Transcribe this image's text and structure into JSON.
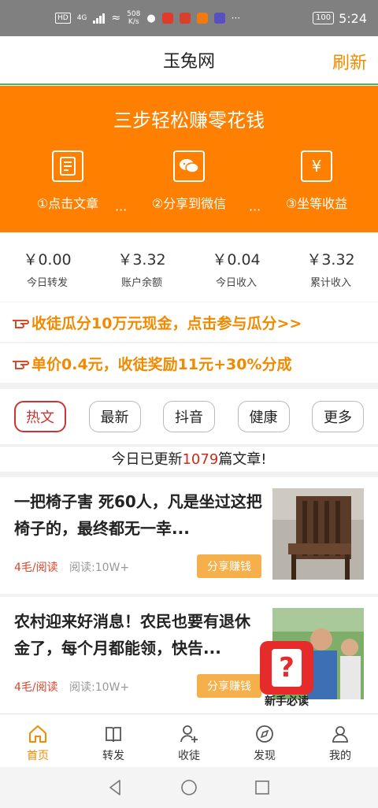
{
  "status_bar": {
    "hd": "HD",
    "network": "4G",
    "speed_value": "508",
    "speed_unit": "K/s",
    "battery": "100",
    "time": "5:24",
    "more": "···"
  },
  "header": {
    "title": "玉兔网",
    "refresh": "刷新"
  },
  "banner": {
    "title": "三步轻松赚零花钱",
    "steps": [
      {
        "icon": "article-icon",
        "label": "①点击文章"
      },
      {
        "icon": "wechat-icon",
        "label": "②分享到微信"
      },
      {
        "icon": "yen-icon",
        "label": "③坐等收益"
      }
    ],
    "separator": "···"
  },
  "stats": [
    {
      "value": "￥0.00",
      "label": "今日转发"
    },
    {
      "value": "￥3.32",
      "label": "账户余额"
    },
    {
      "value": "￥0.04",
      "label": "今日收入"
    },
    {
      "value": "￥3.32",
      "label": "累计收入"
    }
  ],
  "promos": [
    "收徒瓜分10万元现金，点击参与瓜分>>",
    "单价0.4元，收徒奖励11元+30%分成"
  ],
  "tabs": [
    "热文",
    "最新",
    "抖音",
    "健康",
    "更多"
  ],
  "active_tab": "热文",
  "updated": {
    "prefix": "今日已更新",
    "count": "1079",
    "suffix": "篇文章!"
  },
  "articles": [
    {
      "title": "一把椅子害 死60人，凡是坐过这把椅子的，最终都无一幸...",
      "price": "4毛/阅读",
      "reads": "阅读:10W+",
      "share": "分享赚钱"
    },
    {
      "title": "农村迎来好消息！农民也要有退休金了，每个月都能领，快告...",
      "price": "4毛/阅读",
      "reads": "阅读:10W+",
      "share": "分享赚钱"
    }
  ],
  "floating_badge": {
    "symbol": "?",
    "label": "新手必读"
  },
  "bottom_nav": [
    {
      "icon": "home-icon",
      "label": "首页"
    },
    {
      "icon": "book-icon",
      "label": "转发"
    },
    {
      "icon": "user-add-icon",
      "label": "收徒"
    },
    {
      "icon": "compass-icon",
      "label": "发现"
    },
    {
      "icon": "person-icon",
      "label": "我的"
    }
  ],
  "colors": {
    "accent": "#ff8000",
    "promo_text": "#f08a00",
    "active_tab": "#cc3333",
    "price": "#d9472b",
    "share_button": "#f6b04b",
    "badge": "#e62b2b"
  }
}
